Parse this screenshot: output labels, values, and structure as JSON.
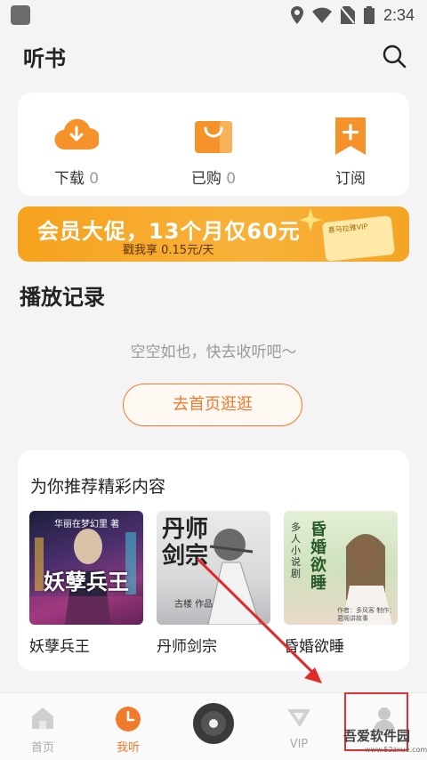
{
  "status_bar": {
    "time": "2:34"
  },
  "header": {
    "title": "听书",
    "search_icon": "search-icon"
  },
  "quick_actions": [
    {
      "label": "下载",
      "count": "0",
      "icon": "cloud-download-icon",
      "color": "#f5922a"
    },
    {
      "label": "已购",
      "count": "0",
      "icon": "shopping-bag-icon",
      "color": "#f5922a"
    },
    {
      "label": "订阅",
      "count": "",
      "icon": "bookmark-plus-icon",
      "color": "#f5922a"
    }
  ],
  "banner": {
    "title": "会员大促，13个月仅60元",
    "subtitle": "戳我享 0.15元/天",
    "card_text": "喜马拉雅VIP"
  },
  "history": {
    "title": "播放记录",
    "empty_text": "空空如也，快去收听吧～",
    "button_label": "去首页逛逛"
  },
  "recommend": {
    "title": "为你推荐精彩内容",
    "books": [
      {
        "title": "妖孽兵王",
        "cover_text": "妖孽兵王",
        "cover_sub": "华丽在梦幻里 著"
      },
      {
        "title": "丹师剑宗",
        "cover_text": "丹师剑宗",
        "cover_sub": "古楼 作品"
      },
      {
        "title": "昏婚欲睡",
        "cover_text": "昏婚欲睡",
        "cover_sub": "多人小说剧",
        "cover_caption": "作者：多风客  制作：君阁讲故事"
      }
    ]
  },
  "tabbar": {
    "tabs": [
      {
        "label": "首页",
        "icon": "home-icon",
        "active": false
      },
      {
        "label": "我听",
        "icon": "clock-icon",
        "active": true
      },
      {
        "label": "",
        "icon": "record-disc-icon",
        "active": false
      },
      {
        "label": "VIP",
        "icon": "vip-icon",
        "active": false
      },
      {
        "label": "",
        "icon": "profile-icon",
        "active": false
      }
    ]
  },
  "watermark": {
    "text": "吾爱软件园",
    "url": "www.52zxue.com"
  },
  "colors": {
    "accent": "#f07a2c",
    "banner": "#f6a21e"
  }
}
